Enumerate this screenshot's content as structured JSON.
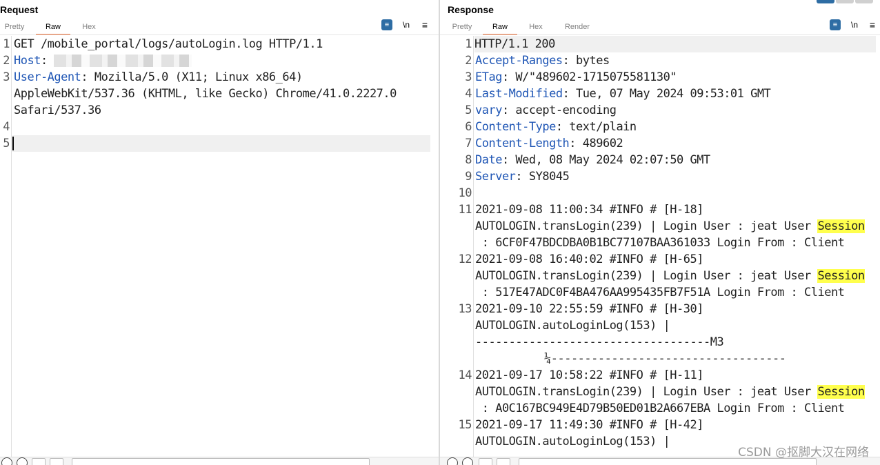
{
  "request": {
    "title": "Request",
    "tabs": [
      "Pretty",
      "Raw",
      "Hex"
    ],
    "active_tab": "Raw",
    "icons": [
      "wrap-lines-icon",
      "newline-icon",
      "menu-icon"
    ],
    "newline_label": "\\n",
    "line_numbers": [
      "1",
      "2",
      "3",
      "4",
      "5"
    ],
    "lines": {
      "l1": "GET /mobile_portal/logs/autoLogin.log HTTP/1.1",
      "l2_key": "Host",
      "l2_sep": ": ",
      "l3_key": "User-Agent",
      "l3_rest": ": Mozilla/5.0 (X11; Linux x86_64)",
      "l3b": "AppleWebKit/537.36 (KHTML, like Gecko) Chrome/41.0.2227.0",
      "l3c": "Safari/537.36"
    }
  },
  "response": {
    "title": "Response",
    "tabs": [
      "Pretty",
      "Raw",
      "Hex",
      "Render"
    ],
    "active_tab": "Raw",
    "icons": [
      "wrap-lines-icon",
      "newline-icon",
      "menu-icon"
    ],
    "newline_label": "\\n",
    "line_numbers": [
      "1",
      "2",
      "3",
      "4",
      "5",
      "6",
      "7",
      "8",
      "9",
      "10",
      "11",
      "12",
      "13",
      "14",
      "15"
    ],
    "lines": {
      "l1": "HTTP/1.1 200",
      "l2_key": "Accept-Ranges",
      "l2_val": ": bytes",
      "l3_key": "ETag",
      "l3_val": ": W/\"489602-1715075581130\"",
      "l4_key": "Last-Modified",
      "l4_val": ": Tue, 07 May 2024 09:53:01 GMT",
      "l5_key": "vary",
      "l5_val": ": accept-encoding",
      "l6_key": "Content-Type",
      "l6_val": ": text/plain",
      "l7_key": "Content-Length",
      "l7_val": ": 489602",
      "l8_key": "Date",
      "l8_val": ": Wed, 08 May 2024 02:07:50 GMT",
      "l9_key": "Server",
      "l9_val": ": SY8045",
      "l11a": "2021-09-08 11:00:34 #INFO # [H-18]",
      "l11b": "AUTOLOGIN.transLogin(239) | Login User : jeat User ",
      "l11b_hl": "Session",
      "l11c": " : 6CF0F47BDCDBA0B1BC77107BAA361033 Login From : Client",
      "l12a": "2021-09-08 16:40:02 #INFO # [H-65]",
      "l12b": "AUTOLOGIN.transLogin(239) | Login User : jeat User ",
      "l12b_hl": "Session",
      "l12c": " : 517E47ADC0F4BA476AA995435FB7F51A Login From : Client",
      "l13a": "2021-09-10 22:55:59 #INFO # [H-30]",
      "l13b": "AUTOLOGIN.autoLoginLog(153) |",
      "l13c": "-----------------------------------M3",
      "l13d": "¼-----------------------------------",
      "l14a": "2021-09-17 10:58:22 #INFO # [H-11]",
      "l14b": "AUTOLOGIN.transLogin(239) | Login User : jeat User ",
      "l14b_hl": "Session",
      "l14c": " : A0C167BC949E4D79B50ED01B2A667EBA Login From : Client",
      "l15a": "2021-09-17 11:49:30 #INFO # [H-42]",
      "l15b": "AUTOLOGIN.autoLoginLog(153) |"
    }
  },
  "watermark": "CSDN @抠脚大汉在网络",
  "colors": {
    "key": "#1f56b5",
    "highlight": "#ffff4d",
    "accent_tab": "#e8662c",
    "wrap_button": "#2e6da4"
  }
}
